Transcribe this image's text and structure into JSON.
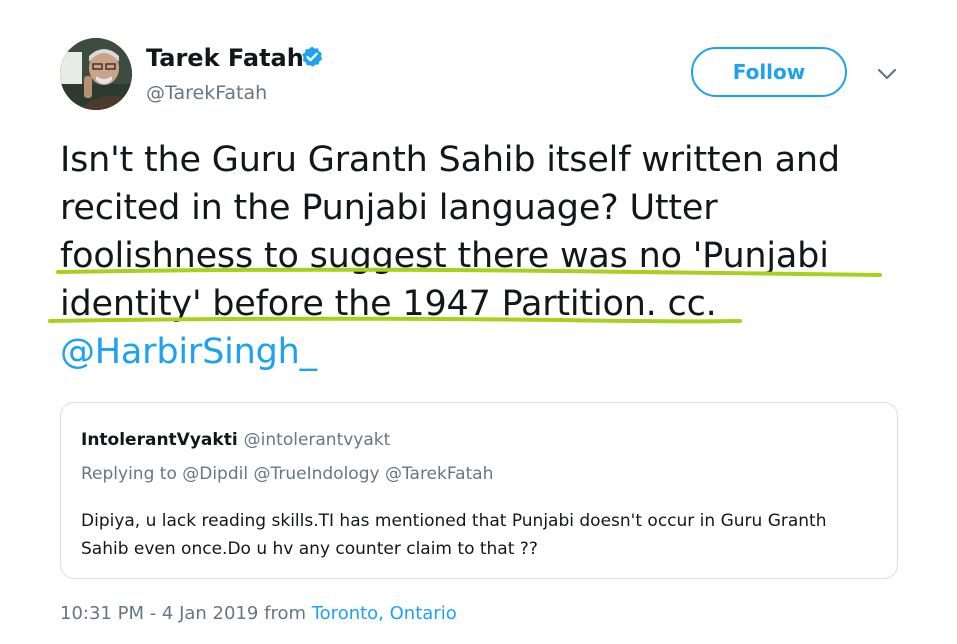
{
  "author": {
    "name": "Tarek Fatah",
    "handle": "@TarekFatah"
  },
  "follow_label": "Follow",
  "icons": {
    "verified": "verified-badge-icon",
    "caret": "chevron-down-icon"
  },
  "tweet": {
    "lines": [
      "Isn't the Guru Granth Sahib itself written and",
      "recited in the Punjabi language? Utter",
      "foolishness to suggest there was no 'Punjabi",
      "identity' before the 1947 Partition. cc."
    ],
    "mention": "@HarbirSingh_"
  },
  "quote": {
    "name": "IntolerantVyakti",
    "handle": "@intolerantvyakt",
    "replying_to": "Replying to @Dipdil @TrueIndology @TarekFatah",
    "body": "Dipiya, u lack reading skills.TI has mentioned that Punjabi doesn't occur in Guru Granth Sahib even once.Do u hv any counter claim to that ??"
  },
  "meta": {
    "time": "10:31 PM - 4 Jan 2019",
    "from": "from",
    "place": "Toronto, Ontario"
  },
  "colors": {
    "accent": "#1da1f2",
    "secondary_text": "#657786",
    "highlight_stroke": "#a6d21d",
    "border": "#d8dfe5"
  }
}
